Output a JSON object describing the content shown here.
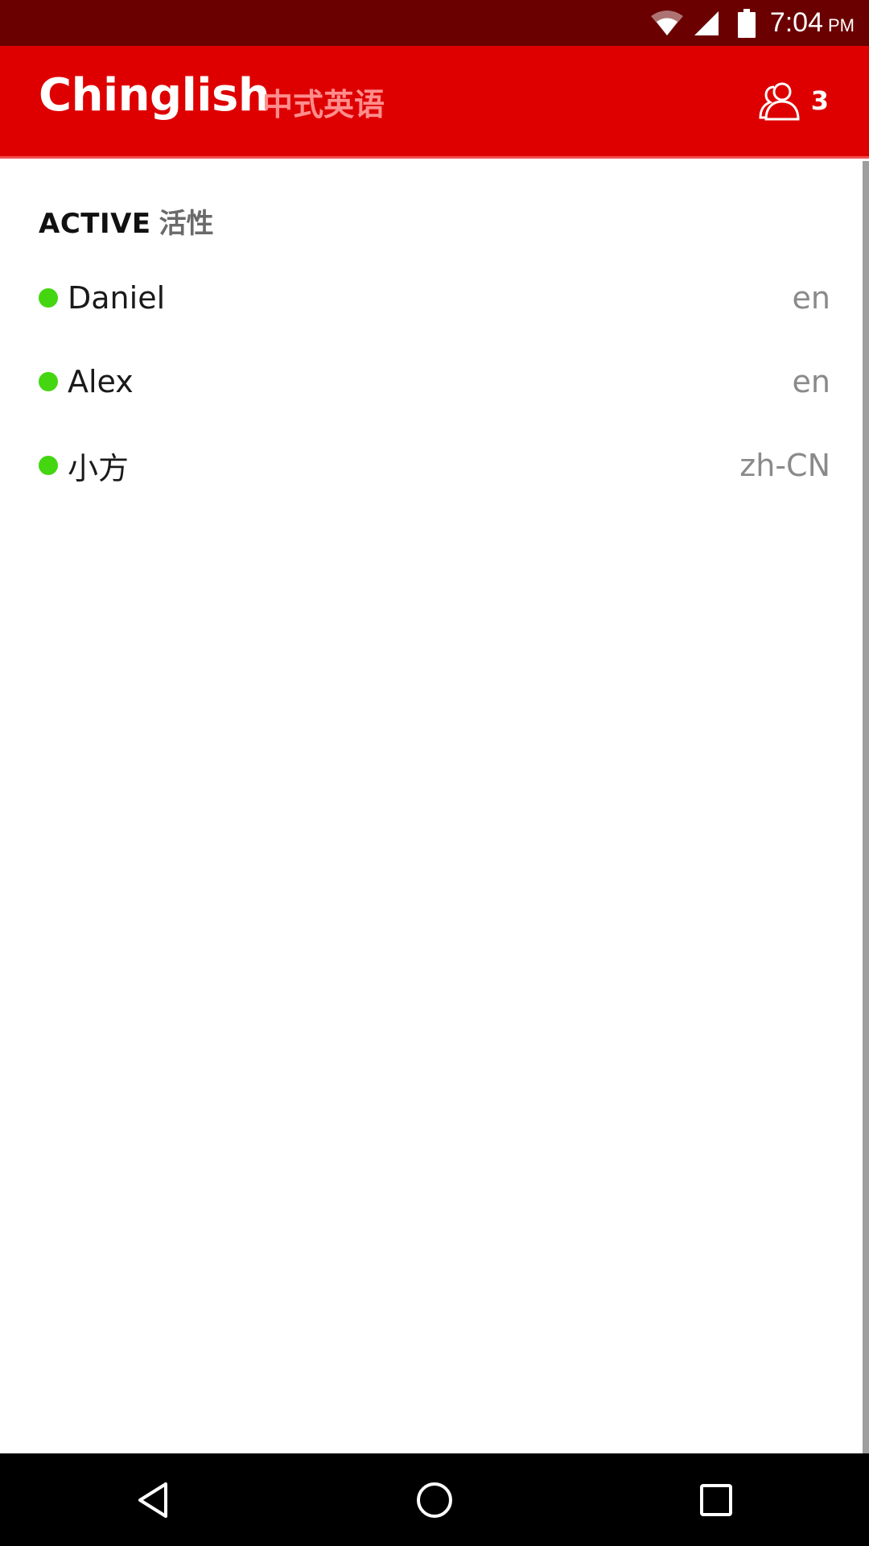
{
  "status_bar": {
    "time": "7:04",
    "ampm": "PM",
    "icons": [
      "wifi-icon",
      "signal-icon",
      "battery-icon"
    ]
  },
  "app_bar": {
    "title": "Chinglish",
    "subtitle": "中式英语",
    "users_icon": "users-icon",
    "user_count": "3"
  },
  "section": {
    "title": "ACTIVE",
    "subtitle": "活性"
  },
  "users": [
    {
      "name": "Daniel",
      "lang": "en",
      "status": "online"
    },
    {
      "name": "Alex",
      "lang": "en",
      "status": "online"
    },
    {
      "name": "小方",
      "lang": "zh-CN",
      "status": "online"
    }
  ],
  "nav_bar": {
    "icons": [
      "back-icon",
      "home-icon",
      "recents-icon"
    ]
  },
  "colors": {
    "status_bar": "#6a0000",
    "app_bar": "#de0000",
    "subtitle": "#ff8d8d",
    "online_dot": "#44d611"
  }
}
